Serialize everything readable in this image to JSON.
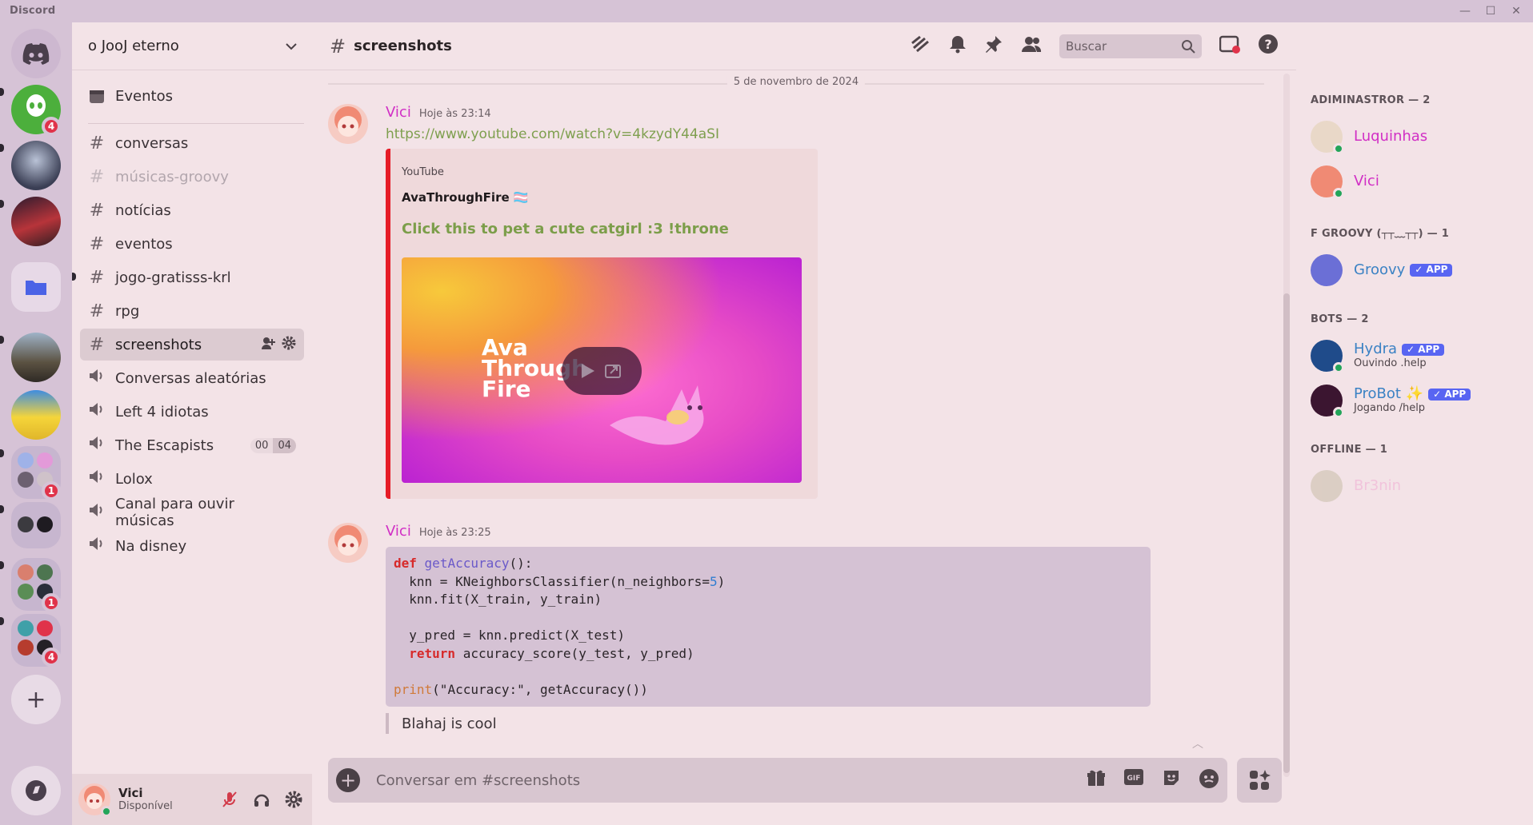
{
  "app": {
    "brand": "Discord"
  },
  "window_controls": {
    "minimize": "—",
    "maximize": "☐",
    "close": "✕"
  },
  "rail": {
    "home_icon": "discord-logo-icon",
    "badges": {
      "server1": "4",
      "folder1": "1",
      "folder2": "1",
      "folder3": "4"
    },
    "add_label": "+"
  },
  "guild": {
    "name": "o JooJ eterno",
    "events_label": "Eventos",
    "channels": [
      {
        "name": "conversas",
        "type": "text"
      },
      {
        "name": "músicas-groovy",
        "type": "text",
        "muted": true
      },
      {
        "name": "notícias",
        "type": "text"
      },
      {
        "name": "eventos",
        "type": "text"
      },
      {
        "name": "jogo-gratisss-krl",
        "type": "text",
        "unread": true
      },
      {
        "name": "rpg",
        "type": "text"
      },
      {
        "name": "screenshots",
        "type": "text",
        "active": true
      },
      {
        "name": "Conversas aleatórias",
        "type": "voice"
      },
      {
        "name": "Left 4 idiotas",
        "type": "voice"
      },
      {
        "name": "The Escapists",
        "type": "voice",
        "count_a": "00",
        "count_b": "04"
      },
      {
        "name": "Lolox",
        "type": "voice"
      },
      {
        "name": "Canal para ouvir músicas",
        "type": "voice"
      },
      {
        "name": "Na disney",
        "type": "voice"
      }
    ]
  },
  "user_panel": {
    "name": "Vici",
    "status": "Disponível"
  },
  "channel_header": {
    "name": "screenshots",
    "search_placeholder": "Buscar"
  },
  "date_separator": "5 de novembro de 2024",
  "messages": [
    {
      "author": "Vici",
      "time": "Hoje às 23:14",
      "link": "https://www.youtube.com/watch?v=4kzydY44aSI",
      "embed": {
        "provider": "YouTube",
        "author": "AvaThroughFire 🏳️‍⚧️",
        "title": "Click this to pet a cute catgirl :3 !throne",
        "thumb_text": "Ava\nThrough\nFire"
      }
    },
    {
      "author": "Vici",
      "time": "Hoje às 23:25",
      "code": [
        "def getAccuracy():",
        "  knn = KNeighborsClassifier(n_neighbors=5)",
        "  knn.fit(X_train, y_train)",
        "",
        "  y_pred = knn.predict(X_test)",
        "  return accuracy_score(y_test, y_pred)",
        "",
        "print(\"Accuracy:\", getAccuracy())"
      ],
      "quote": "Blahaj is cool"
    }
  ],
  "composer": {
    "placeholder": "Conversar em #screenshots"
  },
  "members": {
    "groups": [
      {
        "label": "ADIMINASTROR — 2",
        "members": [
          {
            "name": "Luquinhas",
            "color": "#d12fc5",
            "online": true
          },
          {
            "name": "Vici",
            "color": "#d12fc5",
            "online": true
          }
        ]
      },
      {
        "label": "F GROOVY (┬┬﹏┬┬) — 1",
        "members": [
          {
            "name": "Groovy",
            "color": "#3b82c4",
            "app": "✓ APP"
          }
        ]
      },
      {
        "label": "BOTS — 2",
        "members": [
          {
            "name": "Hydra",
            "color": "#3b82c4",
            "app": "✓ APP",
            "activity": "Ouvindo .help",
            "online": true
          },
          {
            "name": "ProBot ✨",
            "color": "#3b82c4",
            "app": "✓ APP",
            "activity": "Jogando /help",
            "online": true
          }
        ]
      },
      {
        "label": "OFFLINE — 1",
        "members": [
          {
            "name": "Br3nin",
            "color": "#f0a9d2",
            "offline": true
          }
        ]
      }
    ]
  }
}
